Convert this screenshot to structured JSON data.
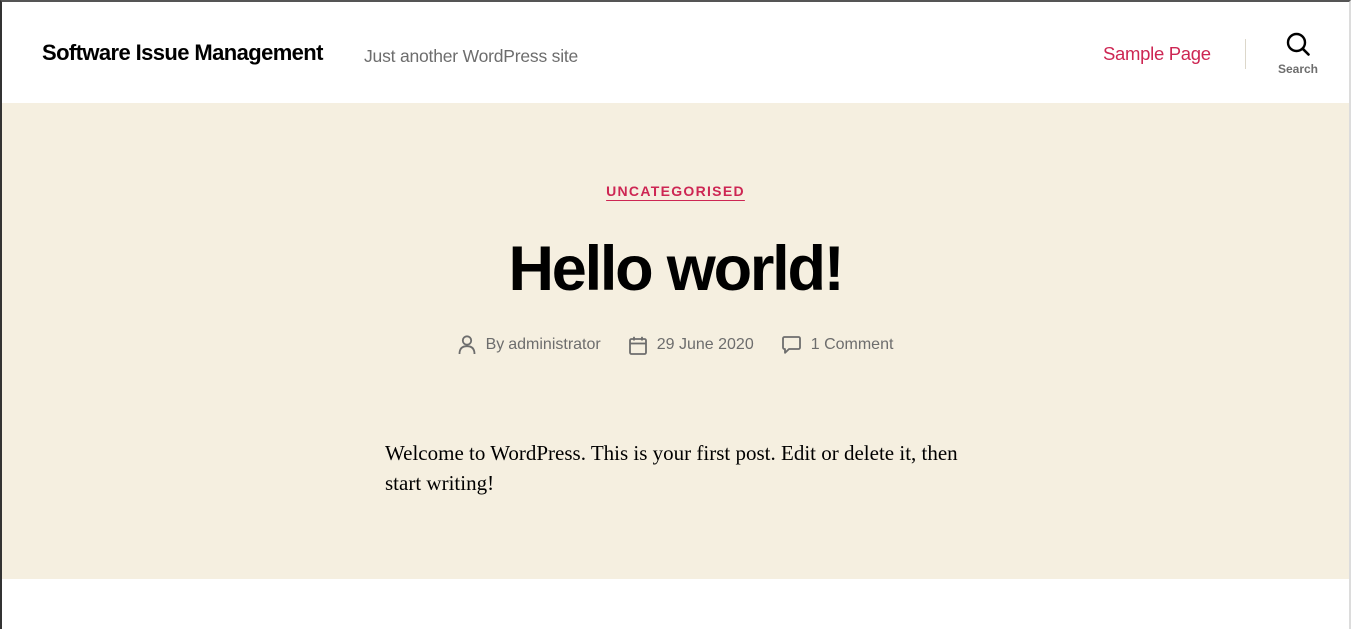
{
  "header": {
    "site_title": "Software Issue Management",
    "site_description": "Just another WordPress site",
    "nav_items": [
      {
        "label": "Sample Page"
      }
    ],
    "search_label": "Search"
  },
  "post": {
    "category": "UNCATEGORISED",
    "title": "Hello world!",
    "meta": {
      "by_label": "By",
      "author": "administrator",
      "date": "29 June 2020",
      "comments": "1 Comment"
    },
    "content": "Welcome to WordPress. This is your first post. Edit or delete it, then start writing!"
  },
  "icons": {
    "search": "search-icon",
    "author": "user-icon",
    "date": "calendar-icon",
    "comments": "comment-icon"
  },
  "colors": {
    "accent": "#cd2653",
    "hero_background": "#f5efe0",
    "secondary_text": "#6d6d6d"
  }
}
